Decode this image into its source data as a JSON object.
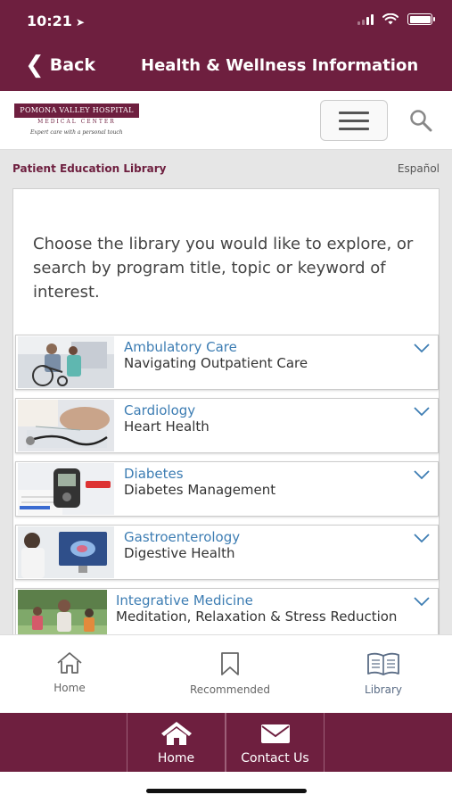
{
  "status": {
    "time": "10:21"
  },
  "nav": {
    "back_label": "Back",
    "title": "Health & Wellness Information"
  },
  "brand": {
    "logo_name": "POMONA VALLEY HOSPITAL",
    "logo_sub": "MEDICAL CENTER",
    "tagline": "Expert care with a personal touch"
  },
  "library": {
    "header": "Patient Education Library",
    "language_link": "Español",
    "intro": "Choose the library you would like to explore, or search by program title, topic or keyword of interest.",
    "items": [
      {
        "category": "Ambulatory Care",
        "title": "Navigating Outpatient Care",
        "thumb_icon": "wheelchair-photo"
      },
      {
        "category": "Cardiology",
        "title": "Heart Health",
        "thumb_icon": "stethoscope-photo"
      },
      {
        "category": "Diabetes",
        "title": "Diabetes Management",
        "thumb_icon": "glucose-meter-photo"
      },
      {
        "category": "Gastroenterology",
        "title": "Digestive Health",
        "thumb_icon": "doctor-screen-photo"
      },
      {
        "category": "Integrative Medicine",
        "title": "Meditation, Relaxation & Stress Reduction",
        "thumb_icon": "park-walk-photo"
      }
    ]
  },
  "tabs": [
    {
      "label": "Home",
      "icon": "home-icon"
    },
    {
      "label": "Recommended",
      "icon": "bookmark-icon"
    },
    {
      "label": "Library",
      "icon": "book-icon"
    }
  ],
  "footer": {
    "home_label": "Home",
    "contact_label": "Contact Us"
  },
  "colors": {
    "brand": "#6e1f3f",
    "link": "#3d7db3",
    "active_tab": "#5a6c85"
  }
}
